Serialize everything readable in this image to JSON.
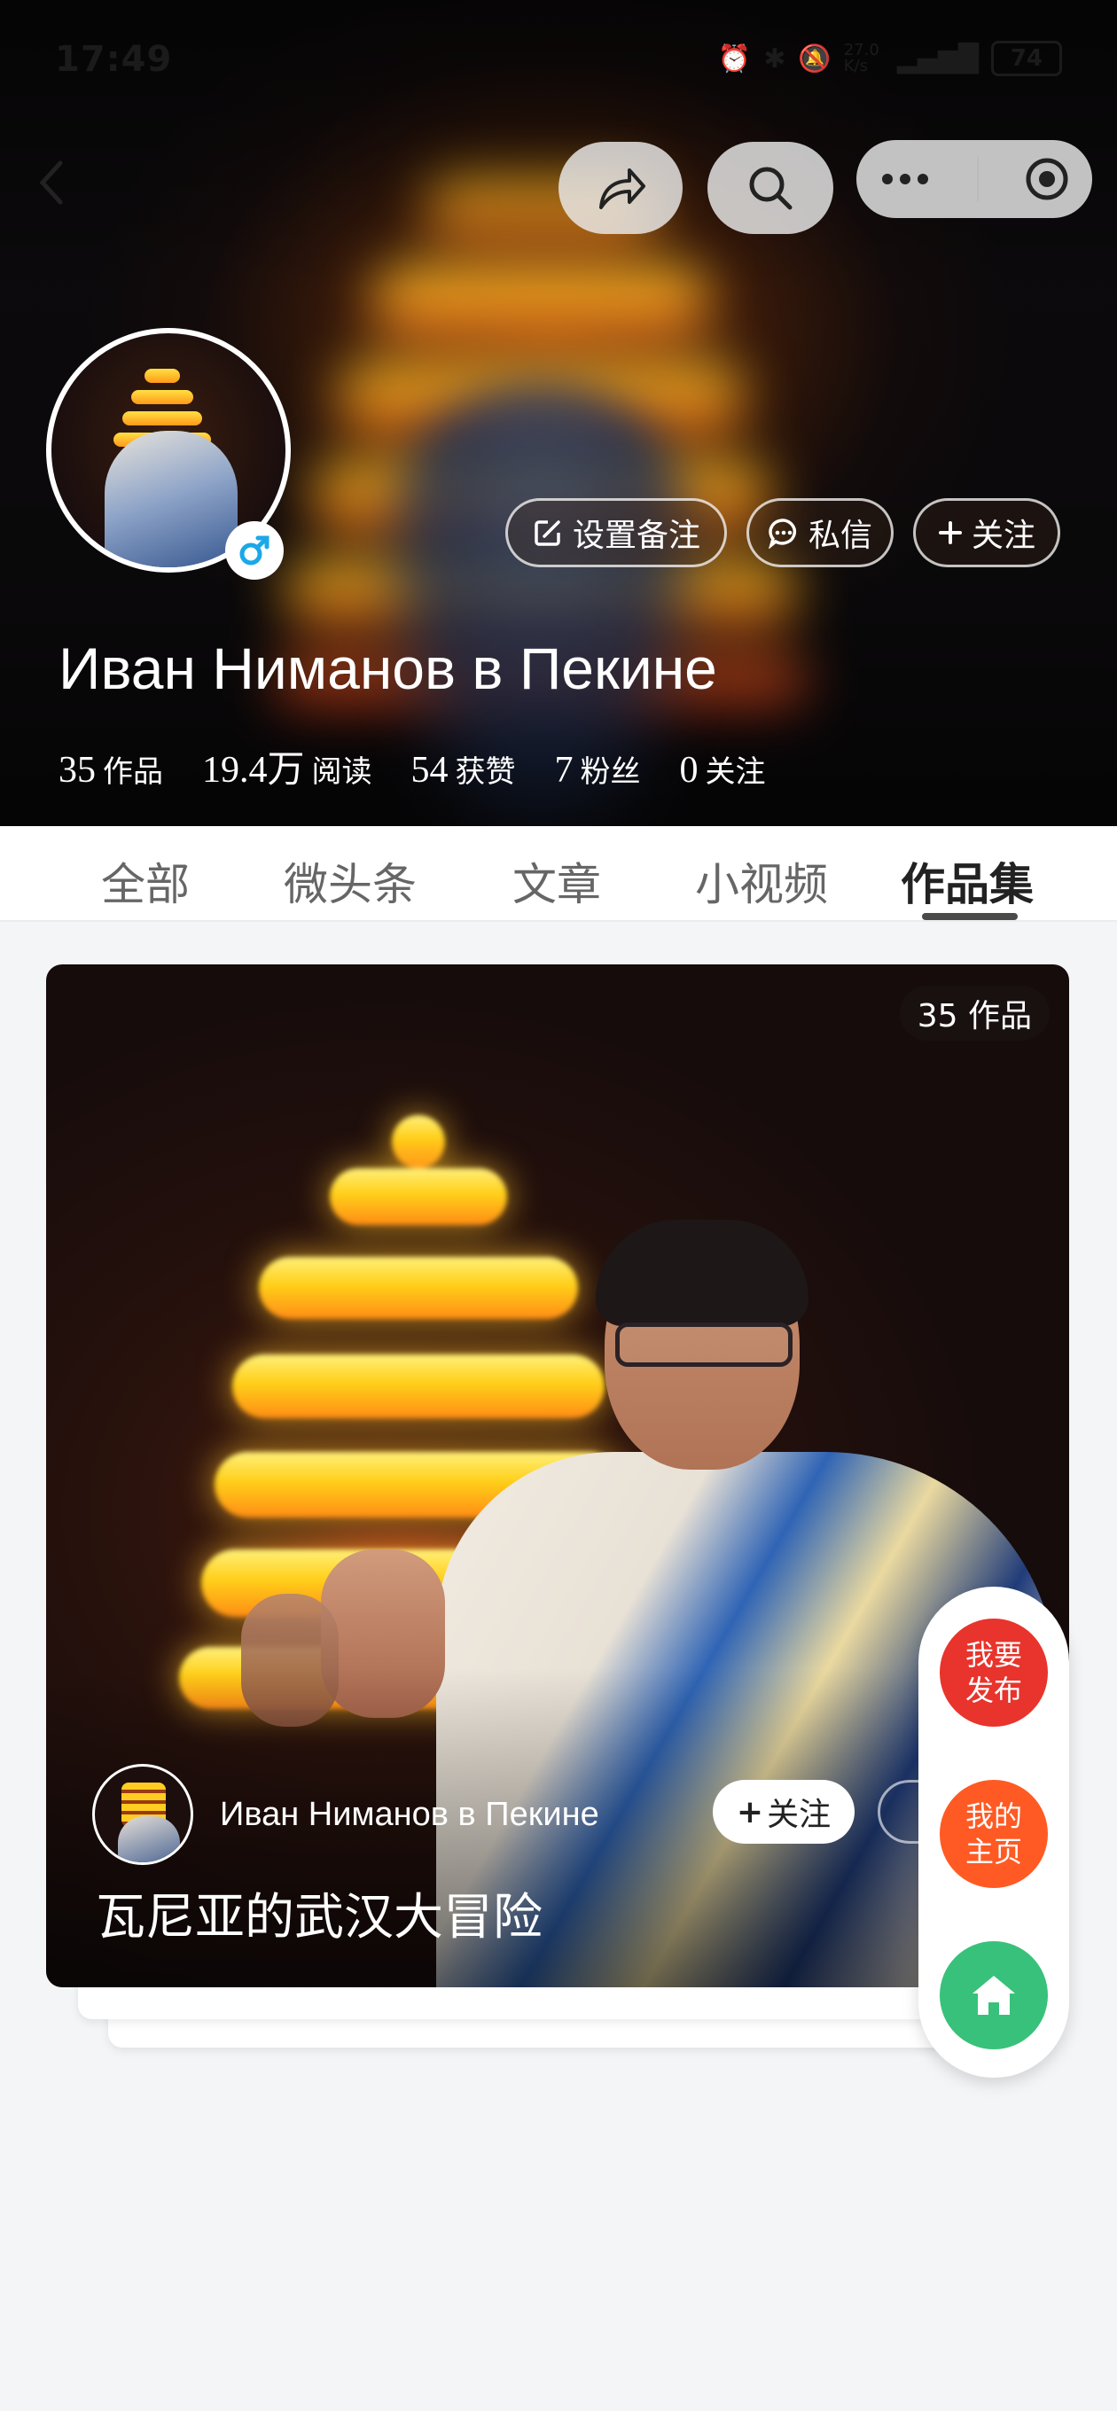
{
  "status_bar": {
    "time": "17:49",
    "speed": "27.0 K/s",
    "battery": "74"
  },
  "profile": {
    "name": "Иван Ниманов в Пекине",
    "actions": {
      "remark": "设置备注",
      "message": "私信",
      "follow": "关注"
    },
    "stats": [
      {
        "value": "35",
        "label": "作品"
      },
      {
        "value": "19.4万",
        "label": "阅读"
      },
      {
        "value": "54",
        "label": "获赞"
      },
      {
        "value": "7",
        "label": "粉丝"
      },
      {
        "value": "0",
        "label": "关注"
      }
    ]
  },
  "tabs": [
    "全部",
    "微头条",
    "文章",
    "小视频",
    "作品集"
  ],
  "collection_card": {
    "count_badge": "35 作品",
    "author": "Иван Ниманов в Пекине",
    "follow": "关注",
    "title": "瓦尼亚的武汉大冒险"
  },
  "fab": {
    "publish": "我要\n发布",
    "my_home": "我的\n主页"
  },
  "colors": {
    "active_tab": "#222222",
    "publish": "#e8342c",
    "my_home": "#ff5a23",
    "home": "#38c17a",
    "gender": "#1aa8e8"
  },
  "icons": [
    "back-icon",
    "share-icon",
    "search-icon",
    "more-icon",
    "target-icon",
    "edit-icon",
    "chat-icon",
    "plus-icon",
    "male-icon",
    "home-icon"
  ]
}
